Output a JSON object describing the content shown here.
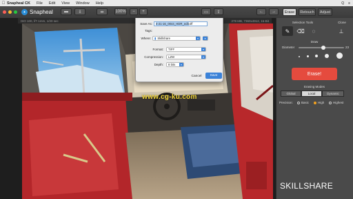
{
  "menubar": {
    "apple": "",
    "items": [
      "Snapheal CK",
      "File",
      "Edit",
      "View",
      "Window",
      "Help"
    ],
    "status": [
      "Q",
      "≡"
    ]
  },
  "titlebar": {
    "app_name": "Snapheal",
    "zoom": "100%"
  },
  "modes": [
    "Erase",
    "Retouch",
    "Adjust"
  ],
  "info": {
    "left": "ISO 100, f/7.1mm, 1/20 sec",
    "right": "278 MB, 7360x4912, 16-Bit"
  },
  "sidebar": {
    "selection_tools": "Selection Tools",
    "clone": "Clone",
    "draw": "Draw",
    "diameter": "Diameter",
    "diameter_value": "23",
    "diameter_level": 0.55,
    "erase_button": "Erase!",
    "erasing_modes": "Erasing Modes",
    "modes": [
      "Global",
      "Local",
      "Dynamic"
    ],
    "active_mode": "Local",
    "precision": "Precision:",
    "precision_options": [
      "Basic",
      "High",
      "Highest"
    ],
    "active_precision": "High"
  },
  "dialog": {
    "save_as_label": "Save As:",
    "filename": "4-21-16_0044_HDR_edit",
    "extension": ".tiff",
    "tags_label": "Tags:",
    "where_label": "Where:",
    "where_value": "Skillshare",
    "format_label": "Format:",
    "format_value": "TIFF",
    "compression_label": "Compression:",
    "compression_value": "LZW",
    "depth_label": "Depth:",
    "depth_value": "8 bits",
    "cancel": "Cancel",
    "save": "Save"
  },
  "watermark": "www.cg-ku.com",
  "brand": "SKILLSHARE",
  "colors": {
    "accent": "#2a8ed8",
    "erase": "#e54b3e",
    "watermark": "#f2d63a"
  }
}
